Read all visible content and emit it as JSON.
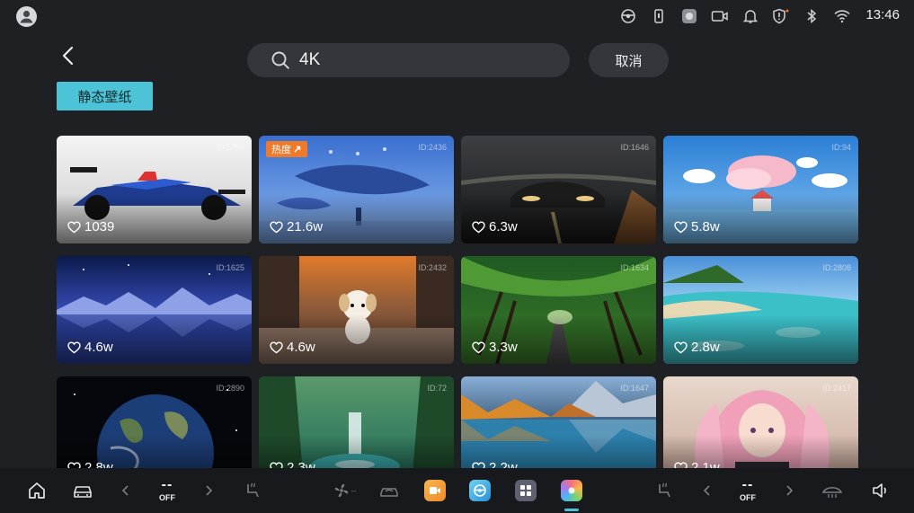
{
  "status_bar": {
    "time": "13:46",
    "icons": [
      "avatar-icon",
      "steering-icon",
      "phone-icon",
      "app-icon",
      "video-icon",
      "bell-icon",
      "shield-icon",
      "bluetooth-icon",
      "wifi-icon"
    ]
  },
  "header": {
    "back_icon": "chevron-left-icon",
    "search_icon": "search-icon",
    "search_value": "4K",
    "cancel_label": "取消",
    "filter_label": "静态壁纸"
  },
  "cards": [
    {
      "id": "ID:5786",
      "likes": "1039",
      "hot": "",
      "theme": "racecar"
    },
    {
      "id": "ID:2436",
      "likes": "21.6w",
      "hot": "热度",
      "theme": "whale"
    },
    {
      "id": "ID:1646",
      "likes": "6.3w",
      "hot": "",
      "theme": "sportscar"
    },
    {
      "id": "ID:94",
      "likes": "5.8w",
      "hot": "",
      "theme": "cloudhouse"
    },
    {
      "id": "ID:1625",
      "likes": "4.6w",
      "hot": "",
      "theme": "mountains"
    },
    {
      "id": "ID:2432",
      "likes": "4.6w",
      "hot": "",
      "theme": "puppy"
    },
    {
      "id": "ID:1634",
      "likes": "3.3w",
      "hot": "",
      "theme": "forestroad"
    },
    {
      "id": "ID:2808",
      "likes": "2.8w",
      "hot": "",
      "theme": "beach"
    },
    {
      "id": "ID:2890",
      "likes": "2.8w",
      "hot": "",
      "theme": "earth"
    },
    {
      "id": "ID:72",
      "likes": "2.3w",
      "hot": "",
      "theme": "waterfall"
    },
    {
      "id": "ID:1647",
      "likes": "2.2w",
      "hot": "",
      "theme": "lake"
    },
    {
      "id": "ID:2417",
      "likes": "2.1w",
      "hot": "",
      "theme": "anime"
    }
  ],
  "dock": {
    "left_temp": "--",
    "left_off": "OFF",
    "right_temp": "--",
    "right_off": "OFF",
    "fan_label": "--",
    "accent": "#4cc3d6"
  }
}
